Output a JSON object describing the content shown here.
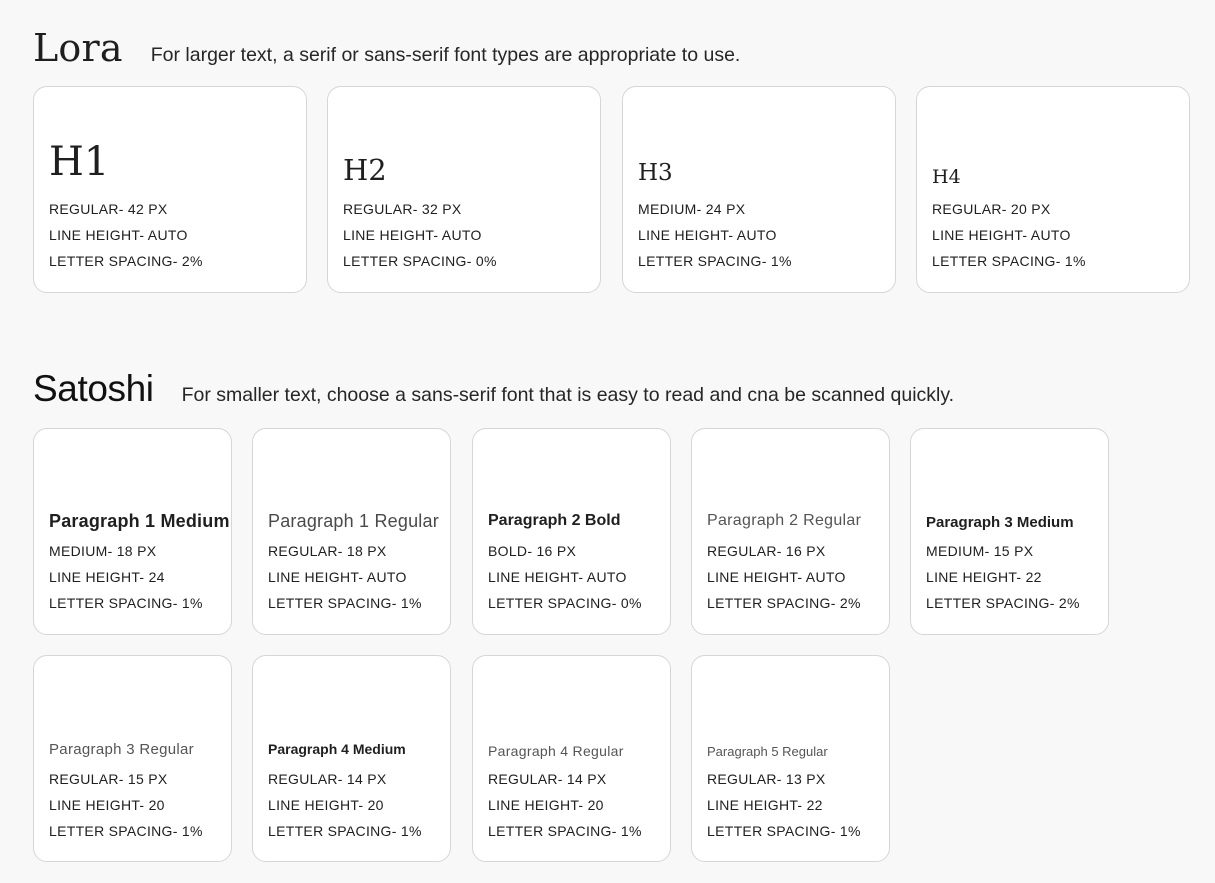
{
  "lora": {
    "font_name": "Lora",
    "description": "For larger text, a serif or sans-serif font types are appropriate to use.",
    "cards": [
      {
        "title": "H1",
        "specs": [
          "REGULAR- 42 PX",
          "LINE HEIGHT- AUTO",
          "LETTER SPACING- 2%"
        ]
      },
      {
        "title": "H2",
        "specs": [
          "REGULAR- 32 PX",
          "LINE HEIGHT- AUTO",
          "LETTER SPACING- 0%"
        ]
      },
      {
        "title": "H3",
        "specs": [
          "MEDIUM- 24 PX",
          "LINE HEIGHT- AUTO",
          "LETTER SPACING- 1%"
        ]
      },
      {
        "title": "H4",
        "specs": [
          "REGULAR- 20 PX",
          "LINE HEIGHT- AUTO",
          "LETTER SPACING- 1%"
        ]
      }
    ]
  },
  "satoshi": {
    "font_name": "Satoshi",
    "description": "For smaller text, choose a sans-serif font that is easy to read and cna be scanned quickly.",
    "cards": [
      {
        "title": "Paragraph 1 Medium",
        "specs": [
          "MEDIUM- 18 PX",
          "LINE HEIGHT- 24",
          "LETTER SPACING- 1%"
        ]
      },
      {
        "title": "Paragraph 1 Regular",
        "specs": [
          "REGULAR- 18 PX",
          "LINE HEIGHT- AUTO",
          "LETTER SPACING- 1%"
        ]
      },
      {
        "title": "Paragraph 2 Bold",
        "specs": [
          "BOLD- 16 PX",
          "LINE HEIGHT- AUTO",
          "LETTER SPACING- 0%"
        ]
      },
      {
        "title": "Paragraph 2 Regular",
        "specs": [
          "REGULAR- 16 PX",
          "LINE HEIGHT- AUTO",
          "LETTER SPACING- 2%"
        ]
      },
      {
        "title": "Paragraph 3 Medium",
        "specs": [
          "MEDIUM- 15 PX",
          "LINE HEIGHT- 22",
          "LETTER SPACING- 2%"
        ]
      },
      {
        "title": "Paragraph 3 Regular",
        "specs": [
          "REGULAR- 15 PX",
          "LINE HEIGHT- 20",
          "LETTER SPACING- 1%"
        ]
      },
      {
        "title": "Paragraph 4 Medium",
        "specs": [
          "REGULAR- 14 PX",
          "LINE HEIGHT- 20",
          "LETTER SPACING- 1%"
        ]
      },
      {
        "title": "Paragraph 4 Regular",
        "specs": [
          "REGULAR- 14 PX",
          "LINE HEIGHT- 20",
          "LETTER SPACING- 1%"
        ]
      },
      {
        "title": "Paragraph 5 Regular",
        "specs": [
          "REGULAR- 13 PX",
          "LINE HEIGHT- 22",
          "LETTER SPACING- 1%"
        ]
      }
    ]
  }
}
